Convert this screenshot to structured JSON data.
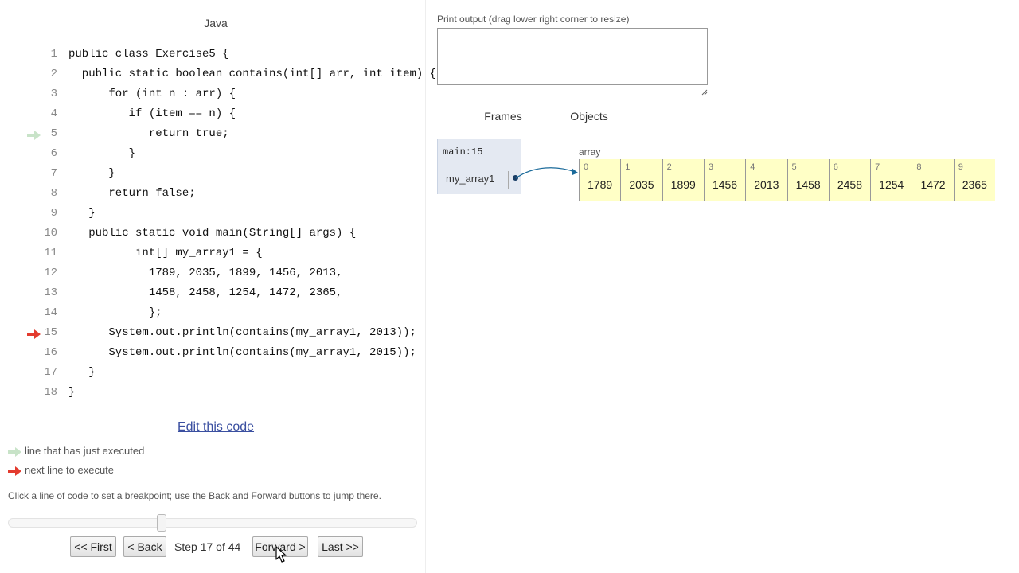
{
  "editor": {
    "language": "Java",
    "code_lines": [
      "public class Exercise5 {",
      "  public static boolean contains(int[] arr, int item) {",
      "      for (int n : arr) {",
      "         if (item == n) {",
      "            return true;",
      "         }",
      "      }",
      "      return false;",
      "   }",
      "   public static void main(String[] args) {",
      "          int[] my_array1 = {",
      "            1789, 2035, 1899, 1456, 2013,",
      "            1458, 2458, 1254, 1472, 2365,",
      "            };",
      "      System.out.println(contains(my_array1, 2013));",
      "      System.out.println(contains(my_array1, 2015));",
      "   }",
      "}"
    ],
    "just_executed_line": 5,
    "next_line": 15,
    "edit_link": "Edit this code"
  },
  "legend": {
    "just_executed": "line that has just executed",
    "next_to_execute": "next line to execute"
  },
  "hint": "Click a line of code to set a breakpoint; use the Back and Forward buttons to jump there.",
  "navigation": {
    "first": "<< First",
    "back": "< Back",
    "step_text": "Step 17 of 44",
    "forward": "Forward >",
    "last": "Last >>",
    "step": 17,
    "total_steps": 44
  },
  "output": {
    "label": "Print output (drag lower right corner to resize)",
    "text": ""
  },
  "visualizer": {
    "frames_label": "Frames",
    "objects_label": "Objects",
    "frame": {
      "name": "main:15",
      "variable": "my_array1"
    },
    "array": {
      "label": "array",
      "values": [
        "1789",
        "2035",
        "1899",
        "1456",
        "2013",
        "1458",
        "2458",
        "1254",
        "1472",
        "2365"
      ]
    }
  },
  "colors": {
    "just_executed_arrow": "#c8e3c8",
    "next_arrow": "#e33b2e",
    "frame_bg": "#e4e9f2",
    "array_bg": "#ffffc6",
    "pointer": "#1a6a9a"
  }
}
